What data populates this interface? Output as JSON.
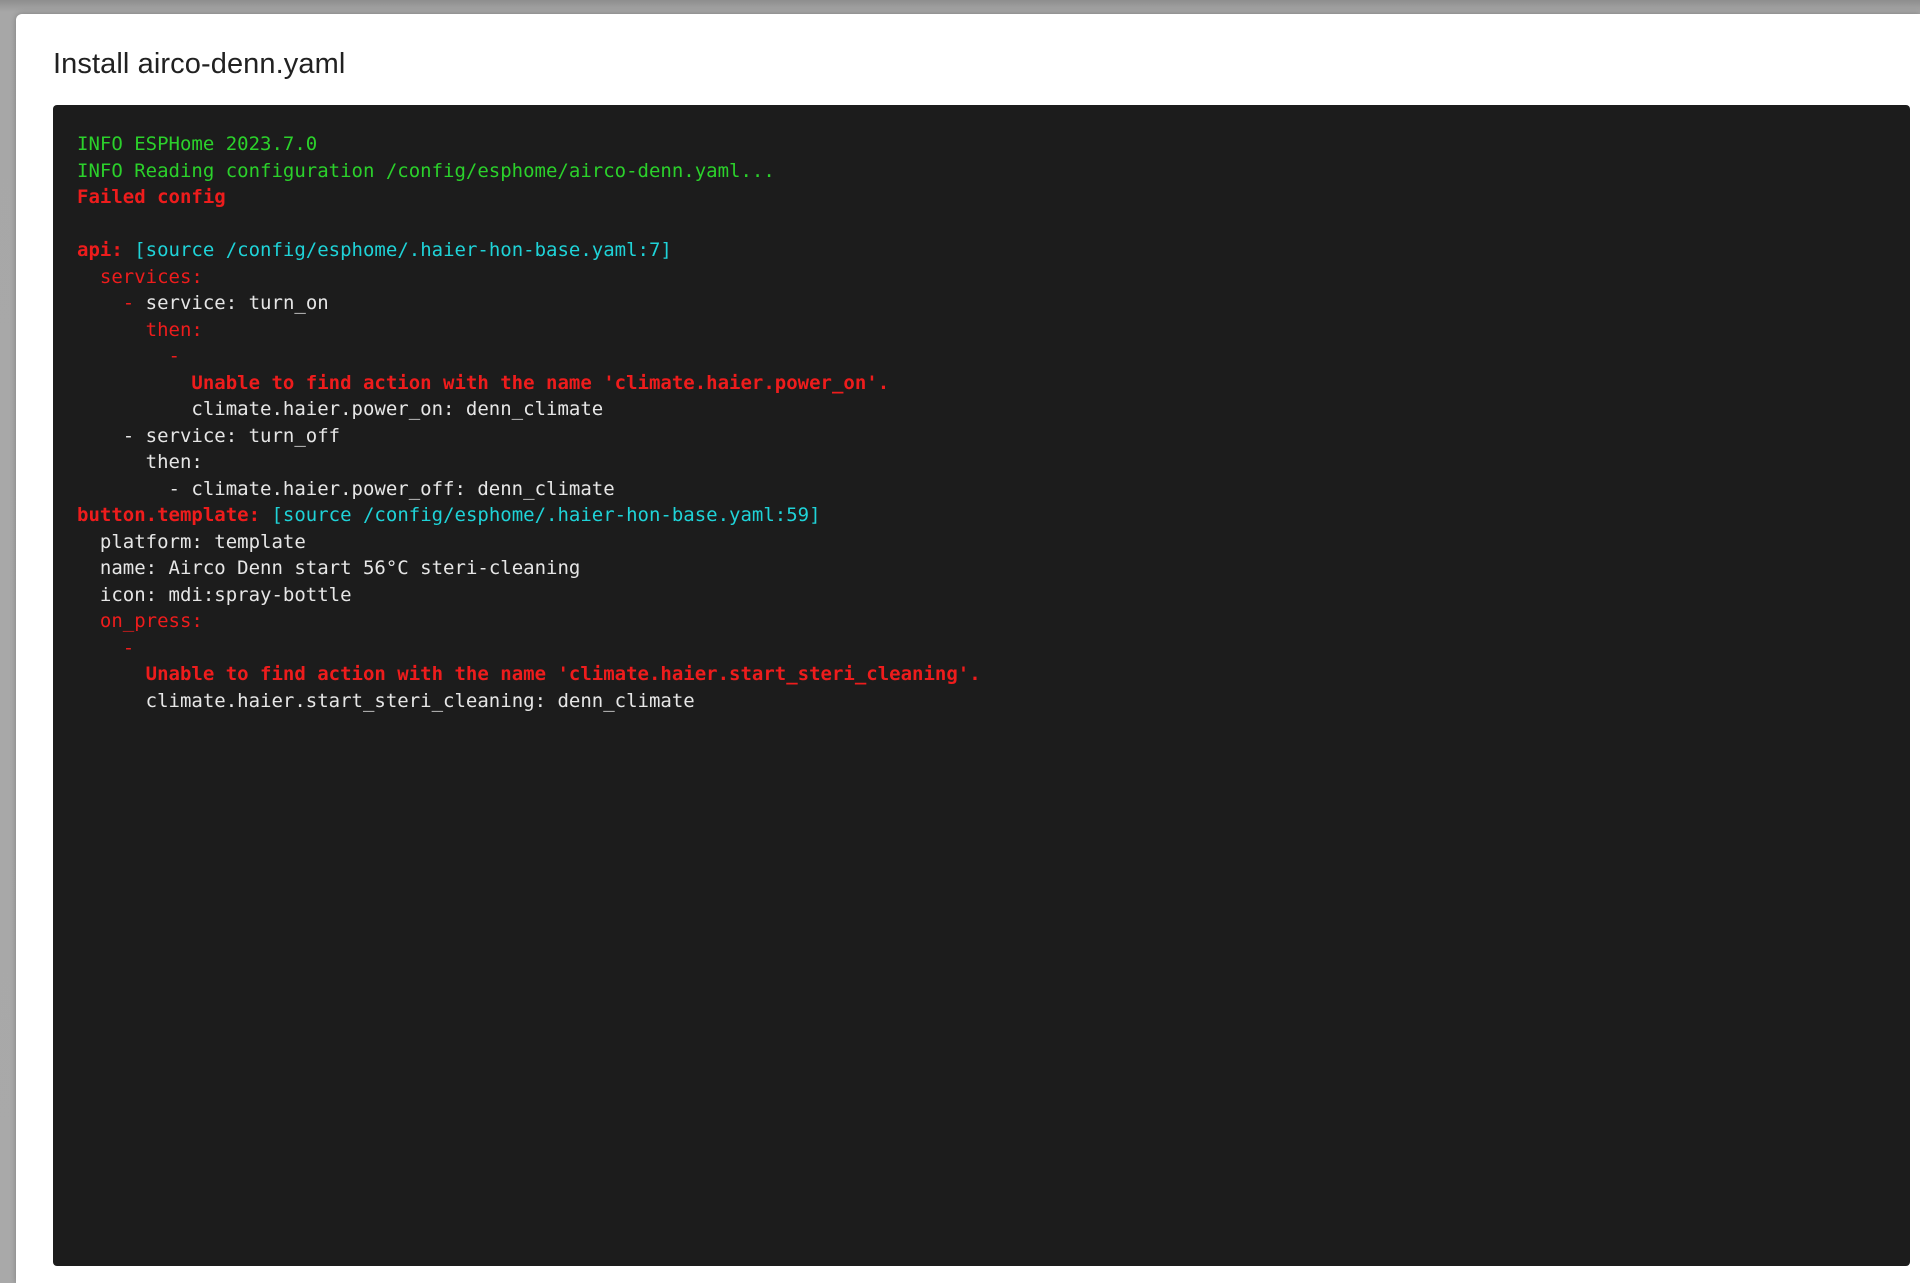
{
  "dialog": {
    "title": "Install airco-denn.yaml"
  },
  "log": {
    "line1": "INFO ESPHome 2023.7.0",
    "line2": "INFO Reading configuration /config/esphome/airco-denn.yaml...",
    "line3": "Failed config",
    "line5_key": "api:",
    "line5_source": "[source /config/esphome/.haier-hon-base.yaml:7]",
    "line6": "services:",
    "line7_dash": "-",
    "line7_text": "service: turn_on",
    "line8": "then:",
    "line9": "-",
    "line10": "Unable to find action with the name 'climate.haier.power_on'.",
    "line11": "climate.haier.power_on: denn_climate",
    "line12": "- service: turn_off",
    "line13": "then:",
    "line14": "- climate.haier.power_off: denn_climate",
    "line15_key": "button.template:",
    "line15_source": "[source /config/esphome/.haier-hon-base.yaml:59]",
    "line16": "platform: template",
    "line17": "name: Airco Denn start 56°C steri-cleaning",
    "line18": "icon: mdi:spray-bottle",
    "line19": "on_press:",
    "line20": "-",
    "line21": "Unable to find action with the name 'climate.haier.start_steri_cleaning'.",
    "line22": "climate.haier.start_steri_cleaning: denn_climate"
  },
  "colors": {
    "info": "#2bd12b",
    "error": "#ee1c1c",
    "source": "#1fd3d8",
    "text": "#e6e6e6",
    "terminal_bg": "#1c1c1c"
  }
}
